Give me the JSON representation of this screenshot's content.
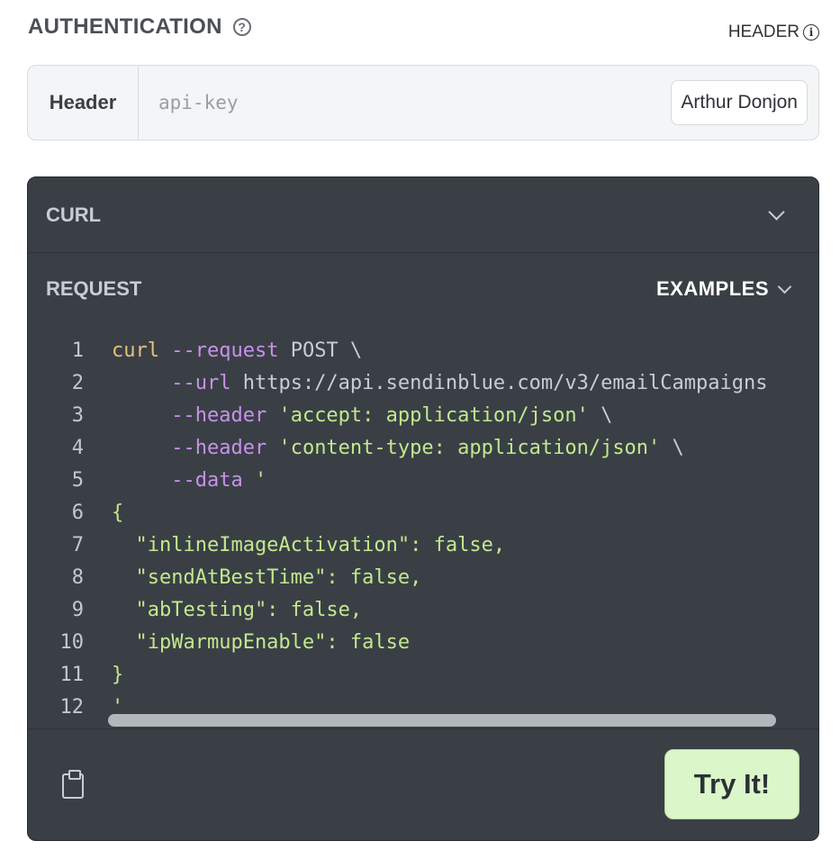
{
  "auth": {
    "title": "AUTHENTICATION",
    "help_symbol": "?",
    "location_label": "HEADER",
    "info_symbol": "i",
    "type_label": "Header",
    "placeholder": "api-key",
    "user": "Arthur Donjon"
  },
  "panel": {
    "language": "CURL",
    "request_label": "REQUEST",
    "examples_label": "EXAMPLES",
    "try_button": "Try It!",
    "lines": [
      {
        "n": "1",
        "tokens": [
          {
            "t": "curl ",
            "c": "cmd"
          },
          {
            "t": "--request",
            "c": "flag"
          },
          {
            "t": " POST \\",
            "c": "plain"
          }
        ]
      },
      {
        "n": "2",
        "tokens": [
          {
            "t": "     ",
            "c": "plain"
          },
          {
            "t": "--url",
            "c": "flag"
          },
          {
            "t": " https://api.sendinblue.com/v3/emailCampaigns",
            "c": "plain"
          }
        ]
      },
      {
        "n": "3",
        "tokens": [
          {
            "t": "     ",
            "c": "plain"
          },
          {
            "t": "--header",
            "c": "flag"
          },
          {
            "t": " ",
            "c": "plain"
          },
          {
            "t": "'accept: application/json'",
            "c": "str"
          },
          {
            "t": " \\",
            "c": "plain"
          }
        ]
      },
      {
        "n": "4",
        "tokens": [
          {
            "t": "     ",
            "c": "plain"
          },
          {
            "t": "--header",
            "c": "flag"
          },
          {
            "t": " ",
            "c": "plain"
          },
          {
            "t": "'content-type: application/json'",
            "c": "str"
          },
          {
            "t": " \\",
            "c": "plain"
          }
        ]
      },
      {
        "n": "5",
        "tokens": [
          {
            "t": "     ",
            "c": "plain"
          },
          {
            "t": "--data",
            "c": "flag"
          },
          {
            "t": " ",
            "c": "plain"
          },
          {
            "t": "'",
            "c": "str"
          }
        ]
      },
      {
        "n": "6",
        "tokens": [
          {
            "t": "{",
            "c": "str"
          }
        ]
      },
      {
        "n": "7",
        "tokens": [
          {
            "t": "  \"inlineImageActivation\": false,",
            "c": "str"
          }
        ]
      },
      {
        "n": "8",
        "tokens": [
          {
            "t": "  \"sendAtBestTime\": false,",
            "c": "str"
          }
        ]
      },
      {
        "n": "9",
        "tokens": [
          {
            "t": "  \"abTesting\": false,",
            "c": "str"
          }
        ]
      },
      {
        "n": "10",
        "tokens": [
          {
            "t": "  \"ipWarmupEnable\": false",
            "c": "str"
          }
        ]
      },
      {
        "n": "11",
        "tokens": [
          {
            "t": "}",
            "c": "str"
          }
        ]
      },
      {
        "n": "12",
        "tokens": [
          {
            "t": "'",
            "c": "str"
          }
        ]
      }
    ]
  }
}
